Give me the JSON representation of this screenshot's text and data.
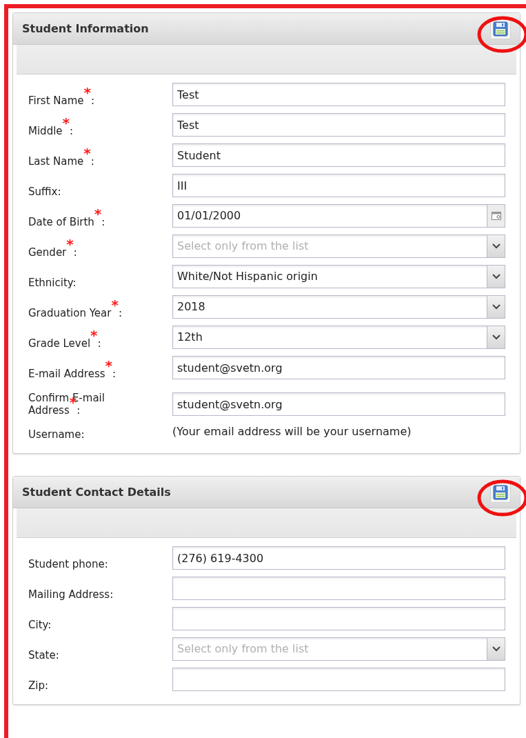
{
  "panels": [
    {
      "title": "Student Information",
      "fields": [
        {
          "kind": "text",
          "label": "First Name$^{*}$:",
          "value": "Test"
        },
        {
          "kind": "text",
          "label": "Middle$^{*}$:",
          "value": "Test"
        },
        {
          "kind": "text",
          "label": "Last Name$^{*}$:",
          "value": "Student"
        },
        {
          "kind": "text",
          "label": "Suffix:",
          "value": "III"
        },
        {
          "kind": "date",
          "label": "Date of Birth$^{*}$:",
          "value": "01/01/2000"
        },
        {
          "kind": "select",
          "label": "Gender$^{*}$:",
          "placeholder": "Select only from the list"
        },
        {
          "kind": "select",
          "label": "Ethnicity:",
          "value": "White/Not Hispanic origin"
        },
        {
          "kind": "select",
          "label": "Graduation Year$^{*}$:",
          "value": "2018"
        },
        {
          "kind": "select",
          "label": "Grade Level$^{*}$:",
          "value": "12th"
        },
        {
          "kind": "text",
          "label": "E-mail Address$^{*}$:",
          "value": "student@svetn.org"
        },
        {
          "kind": "text",
          "label": "Confirm E-mail Address$^{*}$:",
          "value": "student@svetn.org"
        },
        {
          "kind": "static",
          "label": "Username:",
          "value": "(Your email address will be your username)"
        }
      ]
    },
    {
      "title": "Student Contact Details",
      "fields": [
        {
          "kind": "text",
          "label": "Student phone:",
          "value": "(276) 619-4300"
        },
        {
          "kind": "text",
          "label": "Mailing Address:"
        },
        {
          "kind": "text",
          "label": "City:"
        },
        {
          "kind": "select",
          "label": "State:",
          "placeholder": "Select only from the list"
        },
        {
          "kind": "text",
          "label": "Zip:"
        }
      ]
    }
  ]
}
